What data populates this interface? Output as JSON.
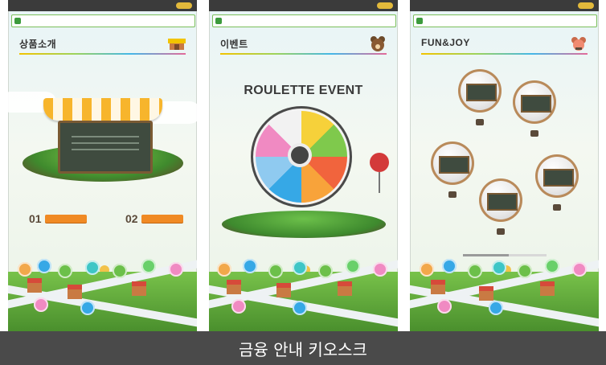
{
  "screens": [
    {
      "title": "상품소개",
      "title_icon": "store-icon",
      "items": [
        "01",
        "02"
      ],
      "accent": "#f08a24"
    },
    {
      "title": "이벤트",
      "title_icon": "bear-icon",
      "event_title": "ROULETTE EVENT",
      "accent": "#36a8e6"
    },
    {
      "title": "FUN&JOY",
      "title_icon": "bear-icon",
      "progress": 0.55,
      "accent": "#d33a3a"
    }
  ],
  "caption": "금융 안내 키오스크"
}
